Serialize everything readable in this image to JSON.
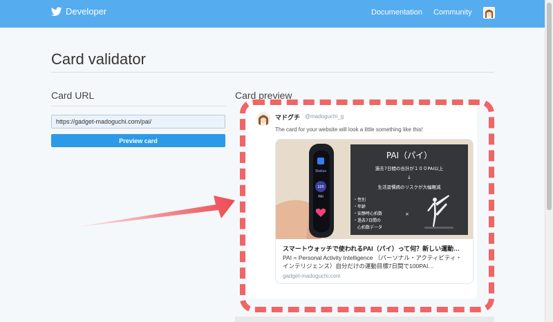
{
  "header": {
    "brand": "Developer",
    "brand_icon": "bird-icon",
    "nav": {
      "documentation": "Documentation",
      "community": "Community"
    }
  },
  "page": {
    "title": "Card validator"
  },
  "card_url": {
    "heading": "Card URL",
    "value": "https://gadget-madoguchi.com/pai/",
    "button": "Preview card"
  },
  "card_preview": {
    "heading": "Card preview",
    "tweet": {
      "name": "マドグチ",
      "handle": "@madoguchi_g",
      "text": "The card for your website will look a little something like this!"
    },
    "card": {
      "title": "スマートウォッチで使われるPAI（パイ）って何？新しい運動…",
      "description": "PAI = Personal Activity Intelligence （パーソナル・アクティビティ・インテリジェンス）自分だけの運動目標7日間で100PAI…",
      "domain": "gadget-madoguchi.com",
      "image": {
        "panel_title": "PAI（パイ）",
        "line1": "過去7日間の合計が１００PAI以上",
        "arrow": "↓",
        "line2": "生活習慣病のリスクが大幅軽減",
        "bullets": [
          "・性別",
          "・年齢",
          "・安静時心拍数",
          "・過去7日間の",
          "　心拍数データ"
        ],
        "cross": "×",
        "band_status": "Status",
        "band_pai": "PAI",
        "band_number": "105"
      }
    }
  },
  "colors": {
    "header_bg": "#55acee",
    "button_bg": "#2c9ae8",
    "highlight": "#f06565",
    "arrow": "#ee4a52"
  }
}
